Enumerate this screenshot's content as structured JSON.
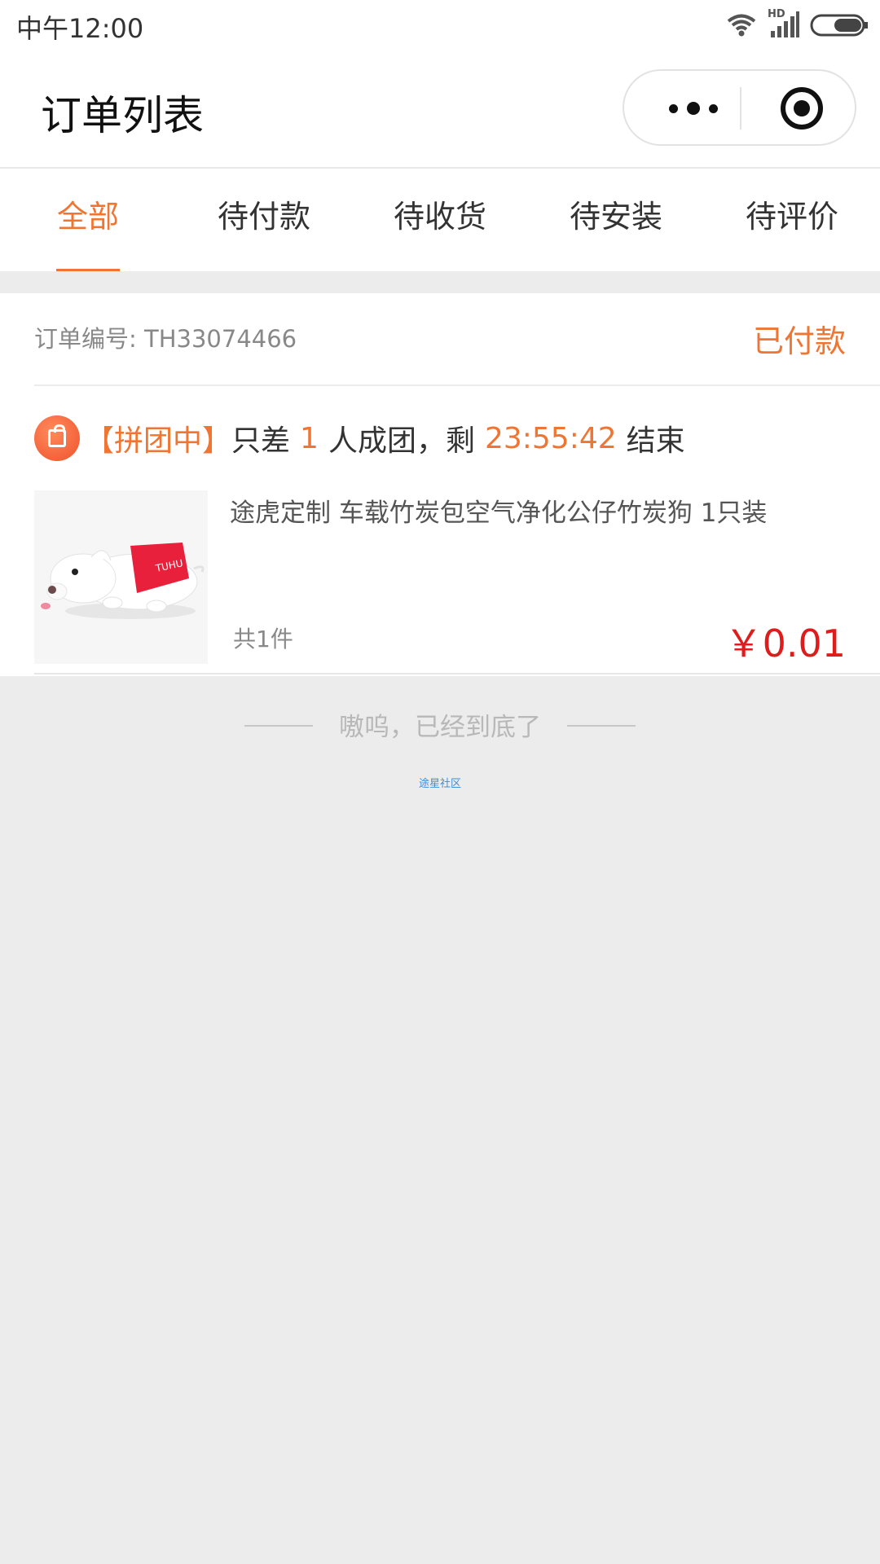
{
  "status_bar": {
    "time": "中午12:00",
    "icons": [
      "wifi-icon",
      "signal-icon",
      "battery-icon"
    ],
    "hd_label": "HD"
  },
  "title_bar": {
    "title": "订单列表",
    "menu_icon": "more-dots-icon",
    "close_icon": "target-close-icon"
  },
  "tabs": [
    {
      "label": "全部",
      "active": true
    },
    {
      "label": "待付款",
      "active": false
    },
    {
      "label": "待收货",
      "active": false
    },
    {
      "label": "待安装",
      "active": false
    },
    {
      "label": "待评价",
      "active": false
    }
  ],
  "order": {
    "order_no_label": "订单编号: TH33074466",
    "status": "已付款",
    "group": {
      "tag": "【拼团中】",
      "prefix": "只差",
      "count": "1",
      "middle": "人成团，剩",
      "countdown": "23:55:42",
      "suffix": "结束"
    },
    "product": {
      "title": "途虎定制 车载竹炭包空气净化公仔竹炭狗 1只装",
      "quantity": "共1件",
      "price": "￥0.01"
    }
  },
  "footer": {
    "end_text": "嗷呜，已经到底了",
    "community_link": "途星社区"
  },
  "colors": {
    "accent": "#f07533",
    "price": "#e01b1b",
    "background": "#ececec"
  }
}
